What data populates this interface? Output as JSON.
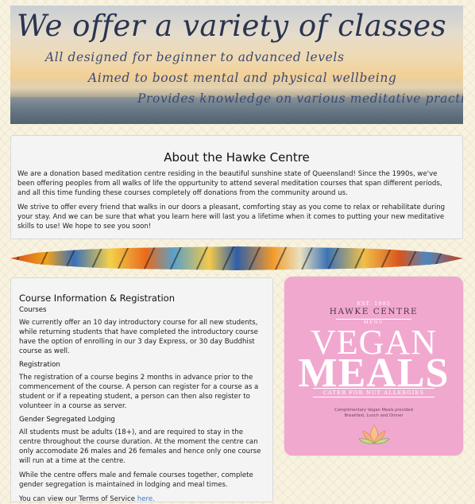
{
  "hero": {
    "title": "We offer a variety of classes",
    "lines": [
      "All designed for beginner to advanced levels",
      "Aimed to boost mental and physical wellbeing",
      "Provides knowledge on various meditative practices"
    ]
  },
  "about": {
    "heading": "About the Hawke Centre",
    "paragraphs": [
      "We are a donation based meditation centre residing in the beautiful sunshine state of Queensland! Since the 1990s, we've been offering peoples from all walks of life the oppurtunity to attend several meditation courses that span different periods, and all this time funding these courses completely off donations from the community around us.",
      "We strive to offer every friend that walks in our doors a pleasant, comforting stay as you come to relax or rehabilitate during your stay. And we can be sure that what you learn here will last you a lifetime when it comes to putting your new meditative skills to use! We hope to see you soon!"
    ]
  },
  "course": {
    "heading": "Course Information & Registration",
    "courses_label": "Courses",
    "courses_text": "We currently offer an 10 day introductory course for all new students, while returning students that have completed the introductory course have the option of enrolling in our 3 day Express, or 30 day Buddhist course as well.",
    "registration_label": "Registration",
    "registration_text": "The registration of a course begins 2 months in advance prior to the commencement of the course. A person can register for a course as a student or if a repeating student, a person can then also register to volunteer in a course as server.",
    "segregated_label": "Gender Segregated Lodging",
    "segregated_text": "All students must be adults (18+), and are required to stay in the centre throughout the course duration. At the moment the centre can only accomodate 26 males and 26 females and hence only one course will run at a time at the centre.",
    "mixed_text": "While the centre offers male and female courses together, complete gender segregation is maintained in lodging and meal times.",
    "terms_prefix": "You can view our Terms of Service ",
    "terms_link": "here."
  },
  "poster": {
    "est": "EST. 1995",
    "brand": "HAWKE CENTRE",
    "menu": "MENU",
    "vegan": "VEGAN",
    "meals": "MEALS",
    "cater": "CATER FOR NUT ALLERGIES",
    "small_line1": "Complimentary Vegan Meals provided",
    "small_line2": "Breakfast, Lunch and Dinner",
    "bg_color": "#f1a8cf"
  }
}
